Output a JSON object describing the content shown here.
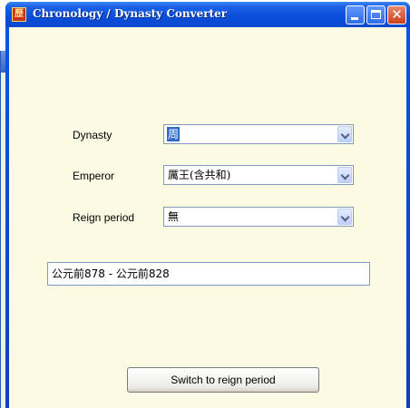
{
  "window": {
    "title": "Chronology / Dynasty Converter",
    "icon_name": "app-icon"
  },
  "form": {
    "dynasty": {
      "label": "Dynasty",
      "value": "周"
    },
    "emperor": {
      "label": "Emperor",
      "value": "厲王(含共和)"
    },
    "reign_period": {
      "label": "Reign period",
      "value": "無"
    }
  },
  "result": {
    "value": "公元前878 - 公元前828"
  },
  "actions": {
    "switch_label": "Switch to reign period"
  },
  "colors": {
    "titlebar": "#0a4edb",
    "client_background": "#fbfbe4",
    "selection": "#316ac5"
  }
}
